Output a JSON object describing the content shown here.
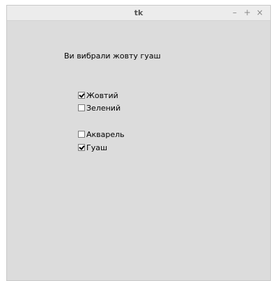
{
  "window": {
    "title": "tk",
    "controls": {
      "minimize": "–",
      "maximize": "+",
      "close": "×"
    }
  },
  "status_text": "Ви вибрали жовту гуаш",
  "colors": [
    {
      "label": "Жовтий",
      "checked": true
    },
    {
      "label": "Зелений",
      "checked": false
    }
  ],
  "paints": [
    {
      "label": "Акварель",
      "checked": false
    },
    {
      "label": "Гуаш",
      "checked": true
    }
  ]
}
